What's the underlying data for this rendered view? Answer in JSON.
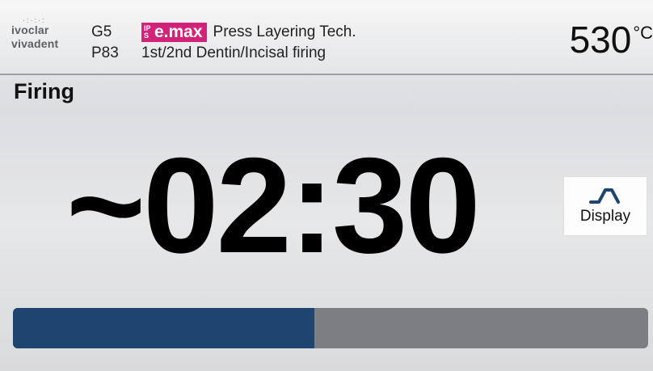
{
  "header": {
    "logo_line1": "ivoclar",
    "logo_line2": "vivadent",
    "code_top": "G5",
    "code_bottom": "P83",
    "brand_prefix": "IPS",
    "brand_name": "e.max",
    "product_title": "Press Layering Tech.",
    "program_name": "1st/2nd Dentin/Incisal firing",
    "temperature_value": "530",
    "temperature_unit": "°C"
  },
  "status": {
    "title": "Firing",
    "time_remaining": "~02:30"
  },
  "display_button": {
    "label": "Display",
    "icon": "firing-curve-icon"
  },
  "progress": {
    "fraction": 0.475,
    "fill_color": "#1e4470",
    "track_color": "#7d7e81"
  },
  "colors": {
    "brand_accent": "#d4217a"
  }
}
